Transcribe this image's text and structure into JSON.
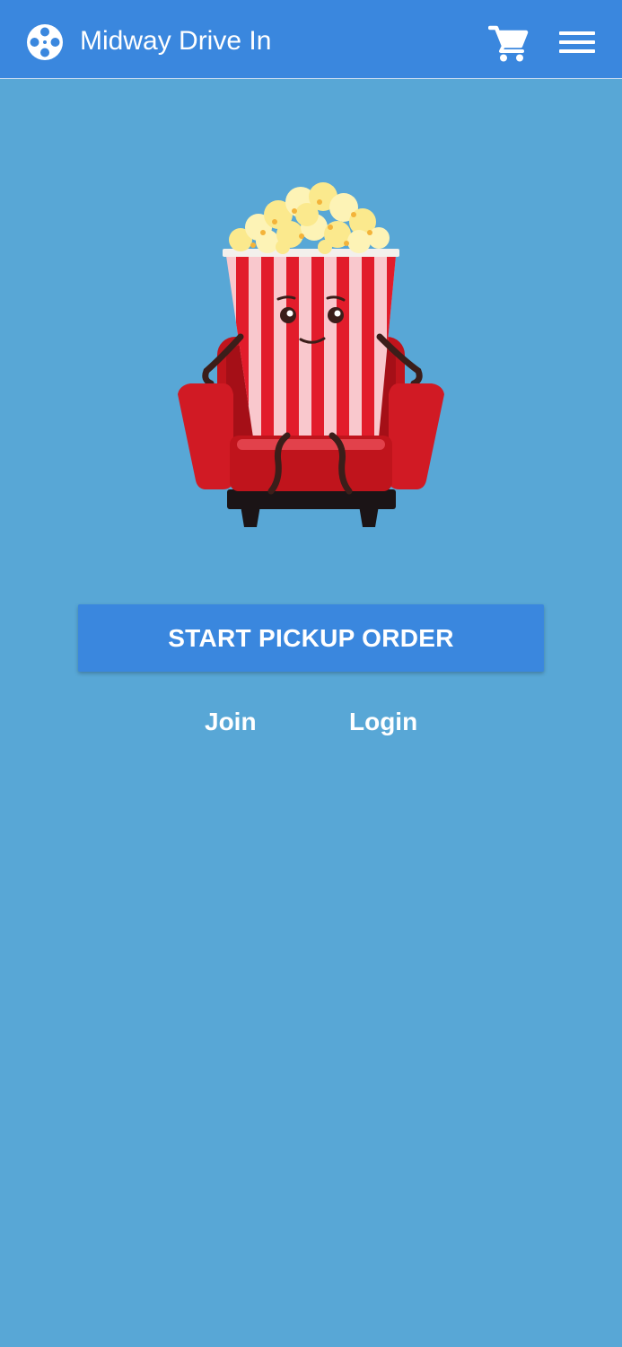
{
  "header": {
    "logo_icon": "film-reel-icon",
    "title": "Midway Drive In",
    "cart_icon": "shopping-cart-icon",
    "menu_icon": "hamburger-menu-icon"
  },
  "hero": {
    "illustration": "popcorn-on-armchair"
  },
  "main": {
    "start_button_label": "START PICKUP ORDER",
    "join_label": "Join",
    "login_label": "Login"
  },
  "colors": {
    "background": "#58a7d6",
    "app_bar": "#3a87de",
    "button": "#3a87de",
    "text": "#ffffff"
  }
}
